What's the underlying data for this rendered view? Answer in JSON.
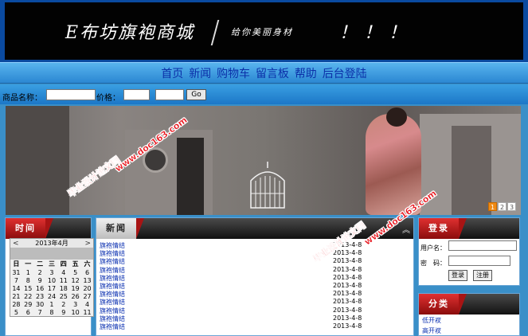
{
  "header": {
    "logo": "E布坊旗袍商城",
    "slogan": "给你美丽身材",
    "exclaim": "！！！"
  },
  "nav": {
    "items": [
      "首页",
      "新闻",
      "购物车",
      "留言板",
      "帮助",
      "后台登陆"
    ]
  },
  "search": {
    "name_label": "商品名称：",
    "price_label": "价格：",
    "name_value": "",
    "price_min": "",
    "price_max": "",
    "go_label": "Go"
  },
  "hero": {
    "pages": [
      "1",
      "2",
      "3"
    ],
    "active_page": "1"
  },
  "time_panel": {
    "title": "时间",
    "calendar": {
      "month_label": "2013年4月",
      "prev": "<",
      "next": ">",
      "weekdays": [
        "日",
        "一",
        "二",
        "三",
        "四",
        "五",
        "六"
      ],
      "weeks": [
        [
          "31",
          "1",
          "2",
          "3",
          "4",
          "5",
          "6"
        ],
        [
          "7",
          "8",
          "9",
          "10",
          "11",
          "12",
          "13"
        ],
        [
          "14",
          "15",
          "16",
          "17",
          "18",
          "19",
          "20"
        ],
        [
          "21",
          "22",
          "23",
          "24",
          "25",
          "26",
          "27"
        ],
        [
          "28",
          "29",
          "30",
          "1",
          "2",
          "3",
          "4"
        ],
        [
          "5",
          "6",
          "7",
          "8",
          "9",
          "10",
          "11"
        ]
      ]
    }
  },
  "news_panel": {
    "title": "新闻",
    "items": [
      {
        "title": "旗袍情结",
        "date": "2013-4-8"
      },
      {
        "title": "旗袍情结",
        "date": "2013-4-8"
      },
      {
        "title": "旗袍情结",
        "date": "2013-4-8"
      },
      {
        "title": "旗袍情结",
        "date": "2013-4-8"
      },
      {
        "title": "旗袍情结",
        "date": "2013-4-8"
      },
      {
        "title": "旗袍情结",
        "date": "2013-4-8"
      },
      {
        "title": "旗袍情结",
        "date": "2013-4-8"
      },
      {
        "title": "旗袍情结",
        "date": "2013-4-8"
      },
      {
        "title": "旗袍情结",
        "date": "2013-4-8"
      },
      {
        "title": "旗袍情结",
        "date": "2013-4-8"
      },
      {
        "title": "旗袍情结",
        "date": "2013-4-8"
      }
    ]
  },
  "login_panel": {
    "title": "登录",
    "user_label": "用户名：",
    "pass_label": "密　码：",
    "user_value": "",
    "pass_value": "",
    "login_button": "登录",
    "register_button": "注册"
  },
  "category_panel": {
    "title": "分类",
    "items": [
      "低开衩",
      "高开衩"
    ]
  },
  "watermarks": [
    "毕业设计论文网",
    "www.doc163.com"
  ],
  "colors": {
    "header_bg": "#020202",
    "nav_text": "#0b2fa8",
    "panel_tab": "#c82020",
    "link": "#0a2fb0",
    "watermark": "#e8141c"
  }
}
